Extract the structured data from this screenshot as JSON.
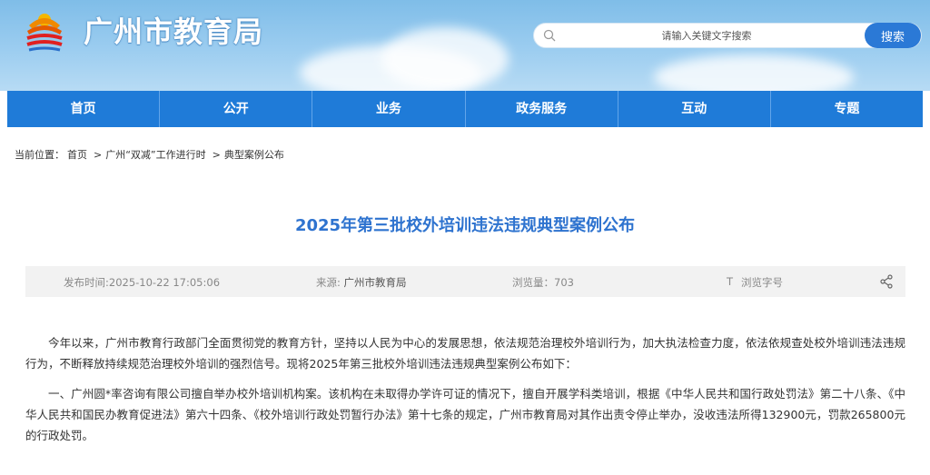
{
  "header": {
    "site_title": "广州市教育局",
    "search_placeholder": "请输入关键文字搜索",
    "search_button": "搜索"
  },
  "nav": {
    "items": [
      "首页",
      "公开",
      "业务",
      "政务服务",
      "互动",
      "专题"
    ]
  },
  "breadcrumb": {
    "prefix": "当前位置：",
    "items": [
      "首页",
      "广州“双减”工作进行时",
      "典型案例公布"
    ],
    "separator": ">"
  },
  "article": {
    "title": "2025年第三批校外培训违法违规典型案例公布",
    "publish_time": "发布时间:2025-10-22 17:05:06",
    "source_label": "来源: ",
    "source_value": "广州市教育局",
    "views_label": "浏览量：",
    "views_value": "703",
    "font_size_label": "浏览字号",
    "font_icon_glyph": "T",
    "paragraphs": [
      "今年以来，广州市教育行政部门全面贯彻党的教育方针，坚持以人民为中心的发展思想，依法规范治理校外培训行为，加大执法检查力度，依法依规查处校外培训违法违规行为，不断释放持续规范治理校外培训的强烈信号。现将2025年第三批校外培训违法违规典型案例公布如下：",
      "一、广州圆*率咨询有限公司擅自举办校外培训机构案。该机构在未取得办学许可证的情况下，擅自开展学科类培训，根据《中华人民共和国行政处罚法》第二十八条、《中华人民共和国民办教育促进法》第六十四条、《校外培训行政处罚暂行办法》第十七条的规定，广州市教育局对其作出责令停止举办，没收违法所得132900元，罚款265800元的行政处罚。"
    ]
  },
  "icons": {
    "logo": "bureau-emblem-icon",
    "search": "search-icon",
    "share": "share-icon",
    "font": "font-size-icon"
  },
  "colors": {
    "nav_bg": "#1f7bd8",
    "title_color": "#2e73cf",
    "search_button_bg": "#2b79d6"
  }
}
